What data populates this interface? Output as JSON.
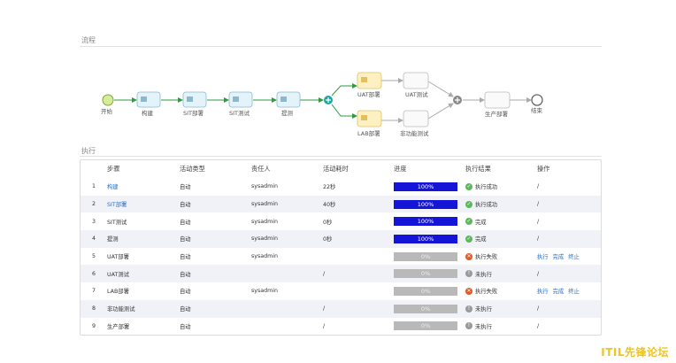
{
  "flow_section": {
    "title": "流程"
  },
  "exec_section": {
    "title": "执行"
  },
  "flow": {
    "start_label": "开始",
    "end_label": "结束",
    "nodes": [
      "构建",
      "SIT部署",
      "SIT测试",
      "提测",
      "UAT部署",
      "UAT测试",
      "LAB部署",
      "非功能测试",
      "生产部署"
    ]
  },
  "table": {
    "headers": [
      "步骤",
      "活动类型",
      "责任人",
      "活动耗时",
      "进度",
      "执行结果",
      "操作"
    ],
    "rows": [
      {
        "idx": "1",
        "step": "构建",
        "type": "自动",
        "owner": "sysadmin",
        "time": "22秒",
        "progress": "100%",
        "result": "执行成功",
        "ops": "/"
      },
      {
        "idx": "2",
        "step": "SIT部署",
        "type": "自动",
        "owner": "sysadmin",
        "time": "40秒",
        "progress": "100%",
        "result": "执行成功",
        "ops": "/"
      },
      {
        "idx": "3",
        "step": "SIT测试",
        "type": "自动",
        "owner": "sysadmin",
        "time": "0秒",
        "progress": "100%",
        "result": "完成",
        "ops": "/"
      },
      {
        "idx": "4",
        "step": "提测",
        "type": "自动",
        "owner": "sysadmin",
        "time": "0秒",
        "progress": "100%",
        "result": "完成",
        "ops": "/"
      },
      {
        "idx": "5",
        "step": "UAT部署",
        "type": "自动",
        "owner": "sysadmin",
        "time": "",
        "progress": "0%",
        "result": "执行失败",
        "ops_links": [
          "执行",
          "完成",
          "终止"
        ]
      },
      {
        "idx": "6",
        "step": "UAT测试",
        "type": "自动",
        "owner": "",
        "time": "/",
        "progress": "0%",
        "result": "未执行",
        "ops": "/"
      },
      {
        "idx": "7",
        "step": "LAB部署",
        "type": "自动",
        "owner": "sysadmin",
        "time": "",
        "progress": "0%",
        "result": "执行失败",
        "ops_links": [
          "执行",
          "完成",
          "终止"
        ]
      },
      {
        "idx": "8",
        "step": "非功能测试",
        "type": "自动",
        "owner": "",
        "time": "/",
        "progress": "0%",
        "result": "未执行",
        "ops": "/"
      },
      {
        "idx": "9",
        "step": "生产部署",
        "type": "自动",
        "owner": "",
        "time": "/",
        "progress": "0%",
        "result": "未执行",
        "ops": "/"
      }
    ]
  },
  "watermark": "ITIL先锋论坛",
  "colors": {
    "progress_full": "#1515d8",
    "progress_empty": "#b9b9b9",
    "link": "#2a6ebd",
    "success": "#5cb85c",
    "fail": "#e05a2b",
    "pending": "#9a9a9a"
  }
}
